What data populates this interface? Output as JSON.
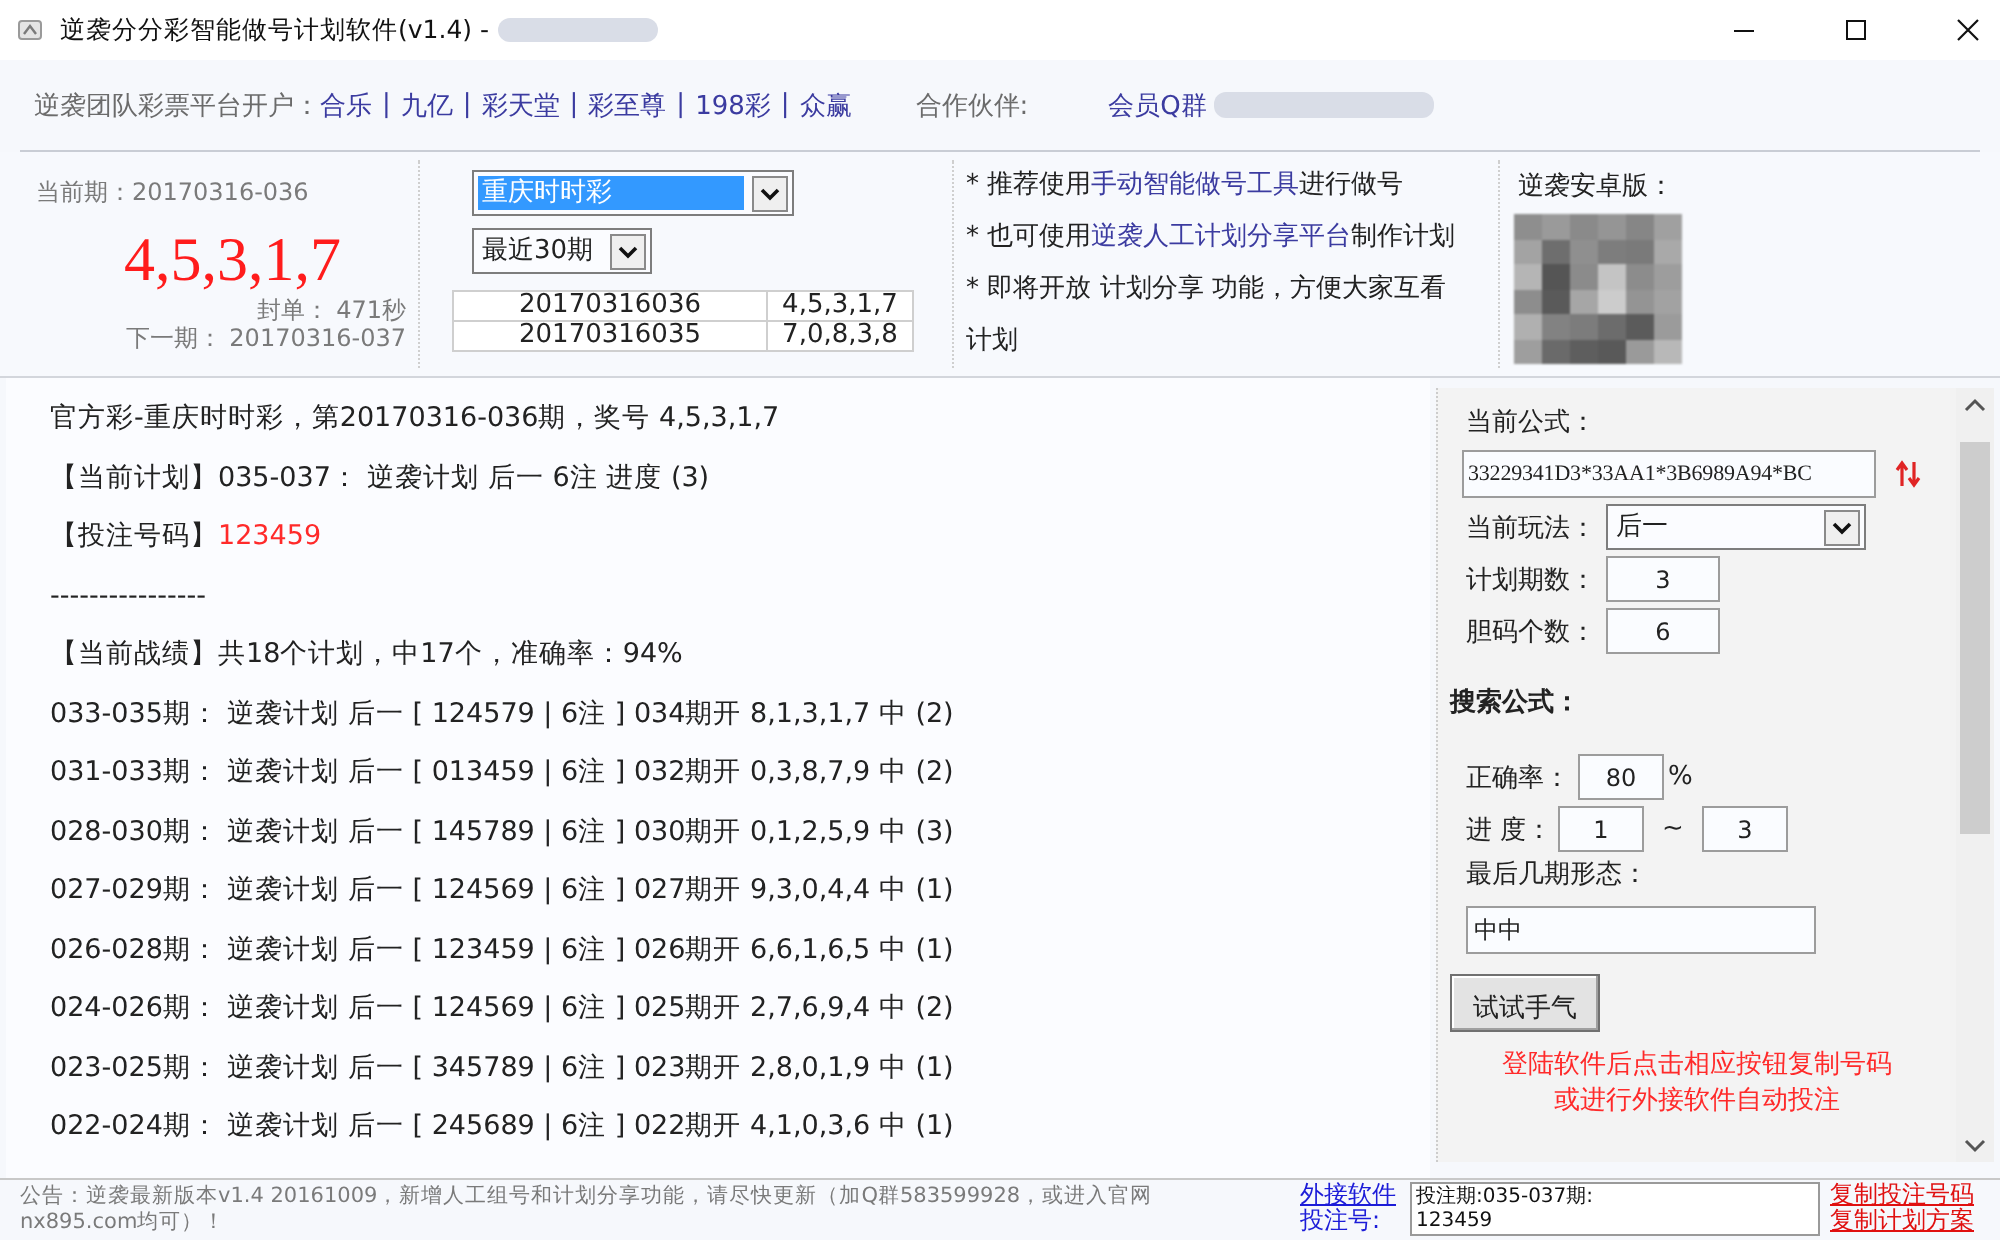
{
  "window": {
    "title": "逆袭分分彩智能做号计划软件(v1.4) -"
  },
  "link_bar": {
    "label": "逆袭团队彩票平台开户：",
    "platforms": [
      {
        "label": "合乐",
        "separator": "|"
      },
      {
        "label": "九亿",
        "separator": "|"
      },
      {
        "label": "彩天堂",
        "separator": "|"
      },
      {
        "label": "彩至尊",
        "separator": "|"
      },
      {
        "label": "198彩",
        "separator": "|"
      },
      {
        "label": "众赢"
      }
    ],
    "partners_label": "合作伙伴:",
    "partner_link": "会员Q群"
  },
  "draw": {
    "current_period": "当前期：20170316-036",
    "numbers": "4,5,3,1,7",
    "close_time": "封单： 471秒",
    "next_period": "下一期： 20170316-037"
  },
  "lottery": {
    "game_select": {
      "value": "重庆时时彩",
      "focused": true
    },
    "range_select": {
      "value": "最近30期",
      "focused": false
    },
    "history": [
      {
        "period": "20170316036",
        "numbers": "4,5,3,1,7"
      },
      {
        "period": "20170316035",
        "numbers": "7,0,8,3,8"
      }
    ]
  },
  "notices": [
    {
      "parts": [
        {
          "kind": "text",
          "text": "* 推荐使用"
        },
        {
          "kind": "link",
          "text": "手动智能做号工具"
        },
        {
          "kind": "text",
          "text": "进行做号"
        }
      ]
    },
    {
      "parts": [
        {
          "kind": "text",
          "text": "* 也可使用"
        },
        {
          "kind": "link",
          "text": "逆袭人工计划分享平台"
        },
        {
          "kind": "text",
          "text": "制作计划"
        }
      ]
    },
    {
      "parts": [
        {
          "kind": "text",
          "text": "* 即将开放 计划分享 功能，方便大家互看计划"
        }
      ]
    }
  ],
  "android": {
    "label": "逆袭安卓版："
  },
  "results": {
    "lines": [
      {
        "kind": "text",
        "text": "官方彩-重庆时时彩，第20170316-036期，奖号 4,5,3,1,7"
      },
      {
        "kind": "text",
        "text": "【当前计划】035-037： 逆袭计划 后一 6注 进度 (3)"
      },
      {
        "kind": "highlight",
        "label": "【投注号码】",
        "value": "123459"
      },
      {
        "kind": "text",
        "text": "----------------"
      },
      {
        "kind": "text",
        "text": "【当前战绩】共18个计划，中17个，准确率：94%"
      },
      {
        "kind": "text",
        "text": "033-035期： 逆袭计划 后一 [ 124579 | 6注 ] 034期开 8,1,3,1,7 中 (2)"
      },
      {
        "kind": "text",
        "text": "031-033期： 逆袭计划 后一 [ 013459 | 6注 ] 032期开 0,3,8,7,9 中 (2)"
      },
      {
        "kind": "text",
        "text": "028-030期： 逆袭计划 后一 [ 145789 | 6注 ] 030期开 0,1,2,5,9 中 (3)"
      },
      {
        "kind": "text",
        "text": "027-029期： 逆袭计划 后一 [ 124569 | 6注 ] 027期开 9,3,0,4,4 中 (1)"
      },
      {
        "kind": "text",
        "text": "026-028期： 逆袭计划 后一 [ 123459 | 6注 ] 026期开 6,6,1,6,5 中 (1)"
      },
      {
        "kind": "text",
        "text": "024-026期： 逆袭计划 后一 [ 124569 | 6注 ] 025期开 2,7,6,9,4 中 (2)"
      },
      {
        "kind": "text",
        "text": "023-025期： 逆袭计划 后一 [ 345789 | 6注 ] 023期开 2,8,0,1,9 中 (1)"
      },
      {
        "kind": "text",
        "text": "022-024期： 逆袭计划 后一 [ 245689 | 6注 ] 022期开 4,1,0,3,6 中 (1)"
      }
    ]
  },
  "formula": {
    "label": "当前公式：",
    "value": "33229341D3*33AA1*3B6989A94*BC",
    "play_label": "当前玩法：",
    "play": "后一",
    "periods_label": "计划期数：",
    "periods": "3",
    "count_label": "胆码个数：",
    "count": "6"
  },
  "search": {
    "title": "搜索公式：",
    "accuracy_label": "正确率：",
    "accuracy": "80",
    "percent": "%",
    "progress_label": "进 度：",
    "progress_from": "1",
    "tilde": "~",
    "progress_to": "3",
    "pattern_label": "最后几期形态：",
    "pattern": "中中",
    "button": "试试手气",
    "hints": [
      "登陆软件后点击相应按钮复制号码",
      "或进行外接软件自动投注"
    ]
  },
  "status_bar": {
    "notice": "公告：逆袭最新版本v1.4 20161009，新增人工组号和计划分享功能，请尽快更新（加Q群583599928，或进入官网nx895.com均可）！",
    "external_link": "外接软件",
    "bet_label": "投注号:",
    "bet_text": "投注期:035-037期:\n123459",
    "copy_links": [
      "复制投注号码",
      "复制计划方案"
    ]
  }
}
